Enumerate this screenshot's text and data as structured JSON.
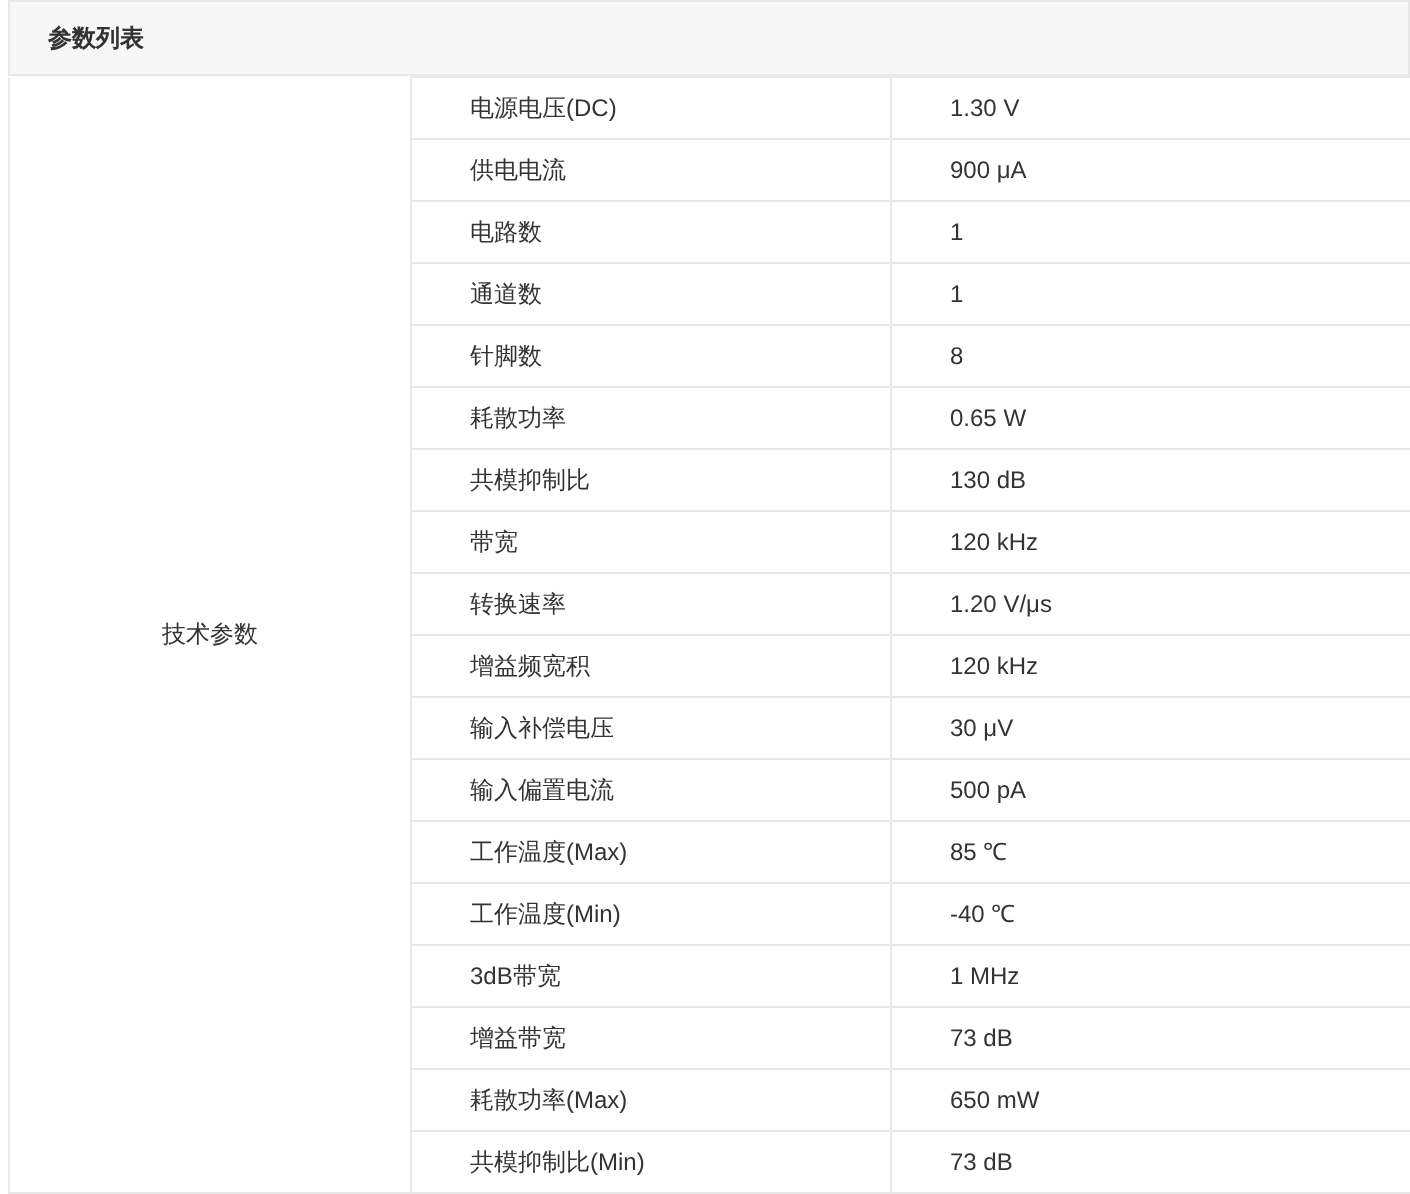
{
  "header": {
    "title": "参数列表"
  },
  "group": {
    "label": "技术参数"
  },
  "rows": [
    {
      "name": "电源电压(DC)",
      "value": "1.30 V"
    },
    {
      "name": "供电电流",
      "value": "900 μA"
    },
    {
      "name": "电路数",
      "value": "1"
    },
    {
      "name": "通道数",
      "value": "1"
    },
    {
      "name": "针脚数",
      "value": "8"
    },
    {
      "name": "耗散功率",
      "value": "0.65 W"
    },
    {
      "name": "共模抑制比",
      "value": "130 dB"
    },
    {
      "name": "带宽",
      "value": "120 kHz"
    },
    {
      "name": "转换速率",
      "value": "1.20 V/μs"
    },
    {
      "name": "增益频宽积",
      "value": "120 kHz"
    },
    {
      "name": "输入补偿电压",
      "value": "30 μV"
    },
    {
      "name": "输入偏置电流",
      "value": "500 pA"
    },
    {
      "name": "工作温度(Max)",
      "value": "85 ℃"
    },
    {
      "name": "工作温度(Min)",
      "value": "-40 ℃"
    },
    {
      "name": "3dB带宽",
      "value": "1 MHz"
    },
    {
      "name": "增益带宽",
      "value": "73 dB"
    },
    {
      "name": "耗散功率(Max)",
      "value": "650 mW"
    },
    {
      "name": "共模抑制比(Min)",
      "value": "73 dB"
    }
  ]
}
